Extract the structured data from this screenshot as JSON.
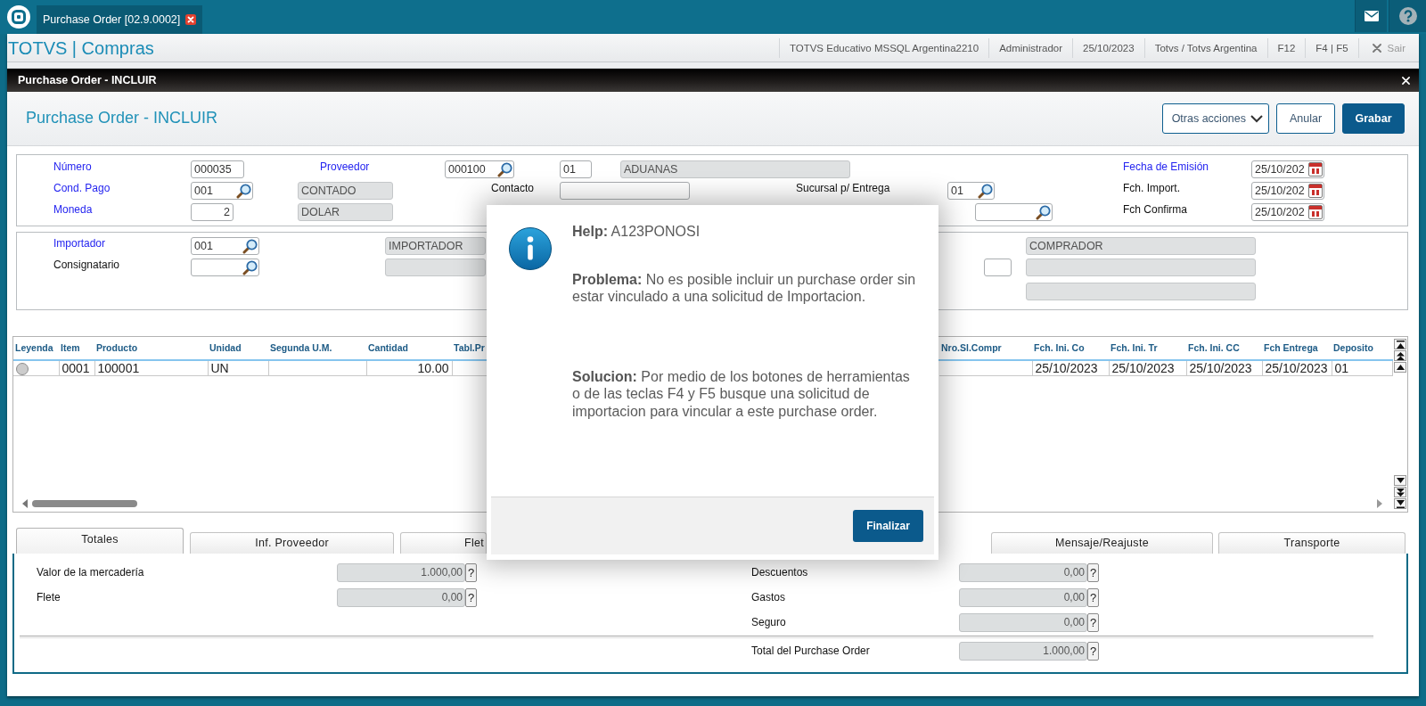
{
  "app_bar": {
    "tabs": [
      {
        "label": "Purchase Order [02.9.0002]",
        "selected": true
      }
    ]
  },
  "header": {
    "title": "TOTVS | Compras",
    "items": [
      {
        "text": "TOTVS Educativo MSSQL Argentina2210",
        "kind": "info"
      },
      {
        "text": "Administrador",
        "kind": "info"
      },
      {
        "text": "25/10/2023",
        "kind": "info"
      },
      {
        "text": "Totvs / Totvs Argentina",
        "kind": "info"
      },
      {
        "text": "F12",
        "kind": "key"
      },
      {
        "text": "F4 | F5",
        "kind": "key"
      },
      {
        "text": "Sair",
        "kind": "exit"
      }
    ]
  },
  "window": {
    "title": "Purchase Order - INCLUIR",
    "heading": "Purchase Order - INCLUIR",
    "actions": [
      {
        "label": "Otras acciones",
        "kind": "menu"
      },
      {
        "label": "Anular",
        "kind": "secondary"
      },
      {
        "label": "Grabar",
        "kind": "primary"
      }
    ]
  },
  "header_form": {
    "fields": [
      {
        "label": "Número",
        "required": true,
        "inputs": [
          {
            "kind": "input",
            "value": "000035"
          }
        ]
      },
      {
        "label": "Proveedor",
        "required": true,
        "inputs": [
          {
            "kind": "lookup",
            "value": "000100"
          },
          {
            "kind": "input",
            "value": "01"
          },
          {
            "kind": "readonly",
            "value": "ADUANAS"
          }
        ]
      },
      {
        "label": "Fecha de Emisión",
        "required": true,
        "inputs": [
          {
            "kind": "date",
            "value": "25/10/202"
          }
        ]
      },
      {
        "label": "Cond. Pago",
        "required": true,
        "inputs": [
          {
            "kind": "lookup",
            "value": "001"
          },
          {
            "kind": "readonly",
            "value": "CONTADO"
          }
        ]
      },
      {
        "label": "Contacto",
        "required": false,
        "inputs": [
          {
            "kind": "input"
          }
        ]
      },
      {
        "label": "Sucursal p/ Entrega",
        "required": false,
        "inputs": [
          {
            "kind": "lookup",
            "value": "01"
          }
        ]
      },
      {
        "label": "Fch. Import.",
        "required": false,
        "inputs": [
          {
            "kind": "date",
            "value": "25/10/202"
          }
        ]
      },
      {
        "label": "Moneda",
        "required": true,
        "inputs": [
          {
            "kind": "number",
            "value": "2"
          },
          {
            "kind": "readonly",
            "value": "DOLAR"
          }
        ]
      },
      {
        "inputs": [
          {
            "kind": "lookup"
          }
        ]
      },
      {
        "label": "Fch Confirma",
        "required": false,
        "inputs": [
          {
            "kind": "date",
            "value": "25/10/202"
          }
        ]
      }
    ]
  },
  "party_form": {
    "fields": [
      {
        "label": "Importador",
        "required": true,
        "inputs": [
          {
            "kind": "lookup",
            "value": "001"
          },
          {
            "kind": "readonly",
            "value": "IMPORTADOR"
          }
        ]
      },
      {
        "inputs": [
          {
            "kind": "readonly",
            "value": "COMPRADOR"
          }
        ]
      },
      {
        "label": "Consignatario",
        "required": false,
        "inputs": [
          {
            "kind": "lookup"
          },
          {
            "kind": "readonly"
          }
        ]
      },
      {
        "inputs": [
          {
            "kind": "input"
          },
          {
            "kind": "readonly"
          }
        ]
      },
      {
        "inputs": [
          {
            "kind": "readonly"
          }
        ]
      }
    ]
  },
  "grid": {
    "columns": [
      "Leyenda",
      "Item",
      "Producto",
      "Unidad",
      "Segunda U.M.",
      "Cantidad",
      "Tabl.Pr",
      "Nro.Sl.Compr",
      "Fch. Ini. Co",
      "Fch. Ini. Tr",
      "Fch. Ini. CC",
      "Fch Entrega",
      "Deposito"
    ],
    "rows": [
      {
        "color": "#cccccc",
        "cells": [
          "",
          "0001",
          "100001",
          "UN",
          "",
          "10.00",
          "",
          "",
          "25/10/2023",
          "25/10/2023",
          "25/10/2023",
          "25/10/2023",
          "01"
        ]
      }
    ]
  },
  "tabs": [
    {
      "label": "Totales",
      "selected": true
    },
    {
      "label": "Inf. Proveedor",
      "selected": false
    },
    {
      "label": "Flet",
      "selected": false
    },
    {
      "label": "Mensaje/Reajuste",
      "selected": false
    },
    {
      "label": "Transporte",
      "selected": false
    }
  ],
  "totals": {
    "left": [
      {
        "label": "Valor de la mercadería",
        "value": "1.000,00",
        "help": "?"
      },
      {
        "label": "Flete",
        "value": "0,00",
        "help": "?"
      }
    ],
    "right": [
      {
        "label": "Descuentos",
        "value": "0,00",
        "help": "?"
      },
      {
        "label": "Gastos",
        "value": "0,00",
        "help": "?"
      },
      {
        "label": "Seguro",
        "value": "0,00",
        "help": "?"
      }
    ],
    "total": {
      "label": "Total del Purchase Order",
      "value": "1.000,00",
      "help": "?"
    }
  },
  "dialog": {
    "help": "**Help:** A123PONOSI",
    "problem": "**Problema:** No es posible incluir un purchase order sin estar vinculado a una solicitud de Importacion.",
    "solution": "**Solucion:** Por medio de los botones de herramientas o de las teclas F4 y F5 busque una solicitud de importacion para vincular a este purchase order.",
    "button": "Finalizar"
  }
}
